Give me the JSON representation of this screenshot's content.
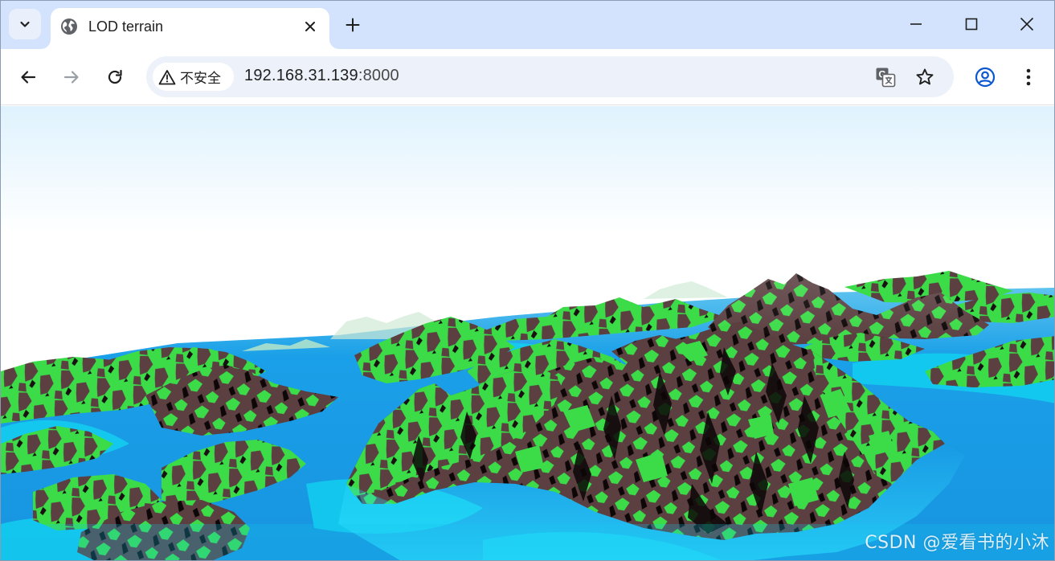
{
  "browser": {
    "tab": {
      "title": "LOD terrain",
      "favicon": "globe-icon"
    },
    "new_tab_icon": "plus-icon",
    "window_controls": [
      "minimize-icon",
      "maximize-icon",
      "close-icon"
    ],
    "address_bar": {
      "security_label": "不安全",
      "security_icon": "warning-triangle-icon",
      "host": "192.168.31.139",
      "port": ":8000"
    },
    "toolbar_icons": [
      "back-arrow-icon",
      "forward-arrow-icon",
      "reload-icon",
      "translate-icon",
      "star-icon",
      "profile-icon",
      "more-vertical-icon"
    ]
  },
  "page": {
    "watermark": "CSDN @爱看书的小沐",
    "colors": {
      "grass": "#3ddc4a",
      "rock": "#5a3e40",
      "water": "#1ea3e6",
      "shallow": "#14d8ef",
      "sky_top": "#dff2fd"
    }
  }
}
